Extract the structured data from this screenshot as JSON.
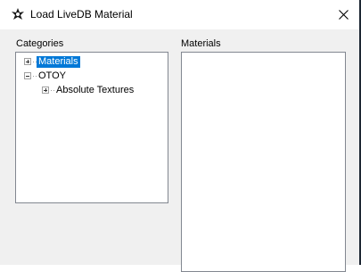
{
  "window": {
    "title": "Load LiveDB Material",
    "close_glyph": "✕"
  },
  "categories": {
    "label": "Categories",
    "tree": [
      {
        "label": "Materials",
        "expanded": false,
        "selected": true
      },
      {
        "label": "OTOY",
        "expanded": true,
        "selected": false
      },
      {
        "label": "Absolute Textures",
        "expanded": false,
        "selected": false
      }
    ]
  },
  "materials": {
    "label": "Materials",
    "items": []
  },
  "colors": {
    "selection": "#0078d7",
    "background": "#f0f0f0",
    "border": "#828790"
  },
  "icons": {
    "app": "octane-logo-icon",
    "close": "close-icon"
  }
}
